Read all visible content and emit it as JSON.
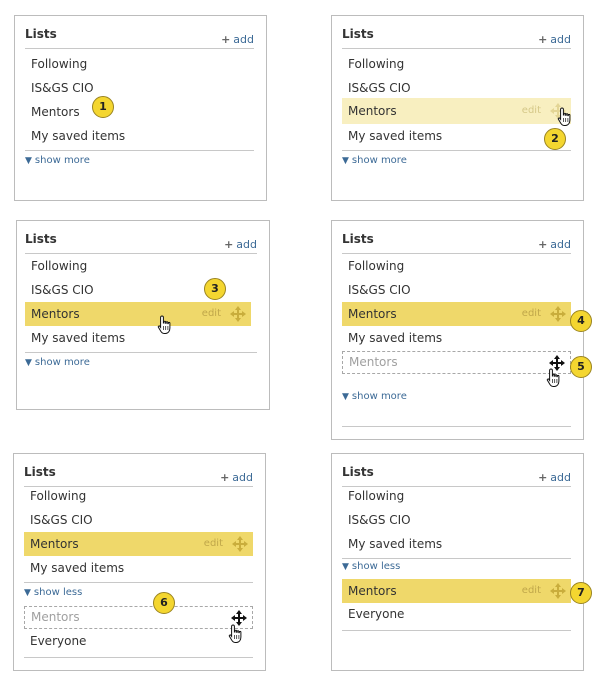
{
  "common": {
    "title": "Lists",
    "add_label": "add",
    "show_more_label": "show more",
    "show_less_label": "show less",
    "edit_label": "edit"
  },
  "items": {
    "following": "Following",
    "isgs": "IS&GS CIO",
    "mentors": "Mentors",
    "saved": "My saved items",
    "everyone": "Everyone"
  },
  "badges": [
    "1",
    "2",
    "3",
    "4",
    "5",
    "6",
    "7"
  ],
  "colors": {
    "highlight": "#efd86a",
    "hover_highlight": "#f8efc0",
    "link": "#3c6a96",
    "badge": "#f4d630"
  }
}
